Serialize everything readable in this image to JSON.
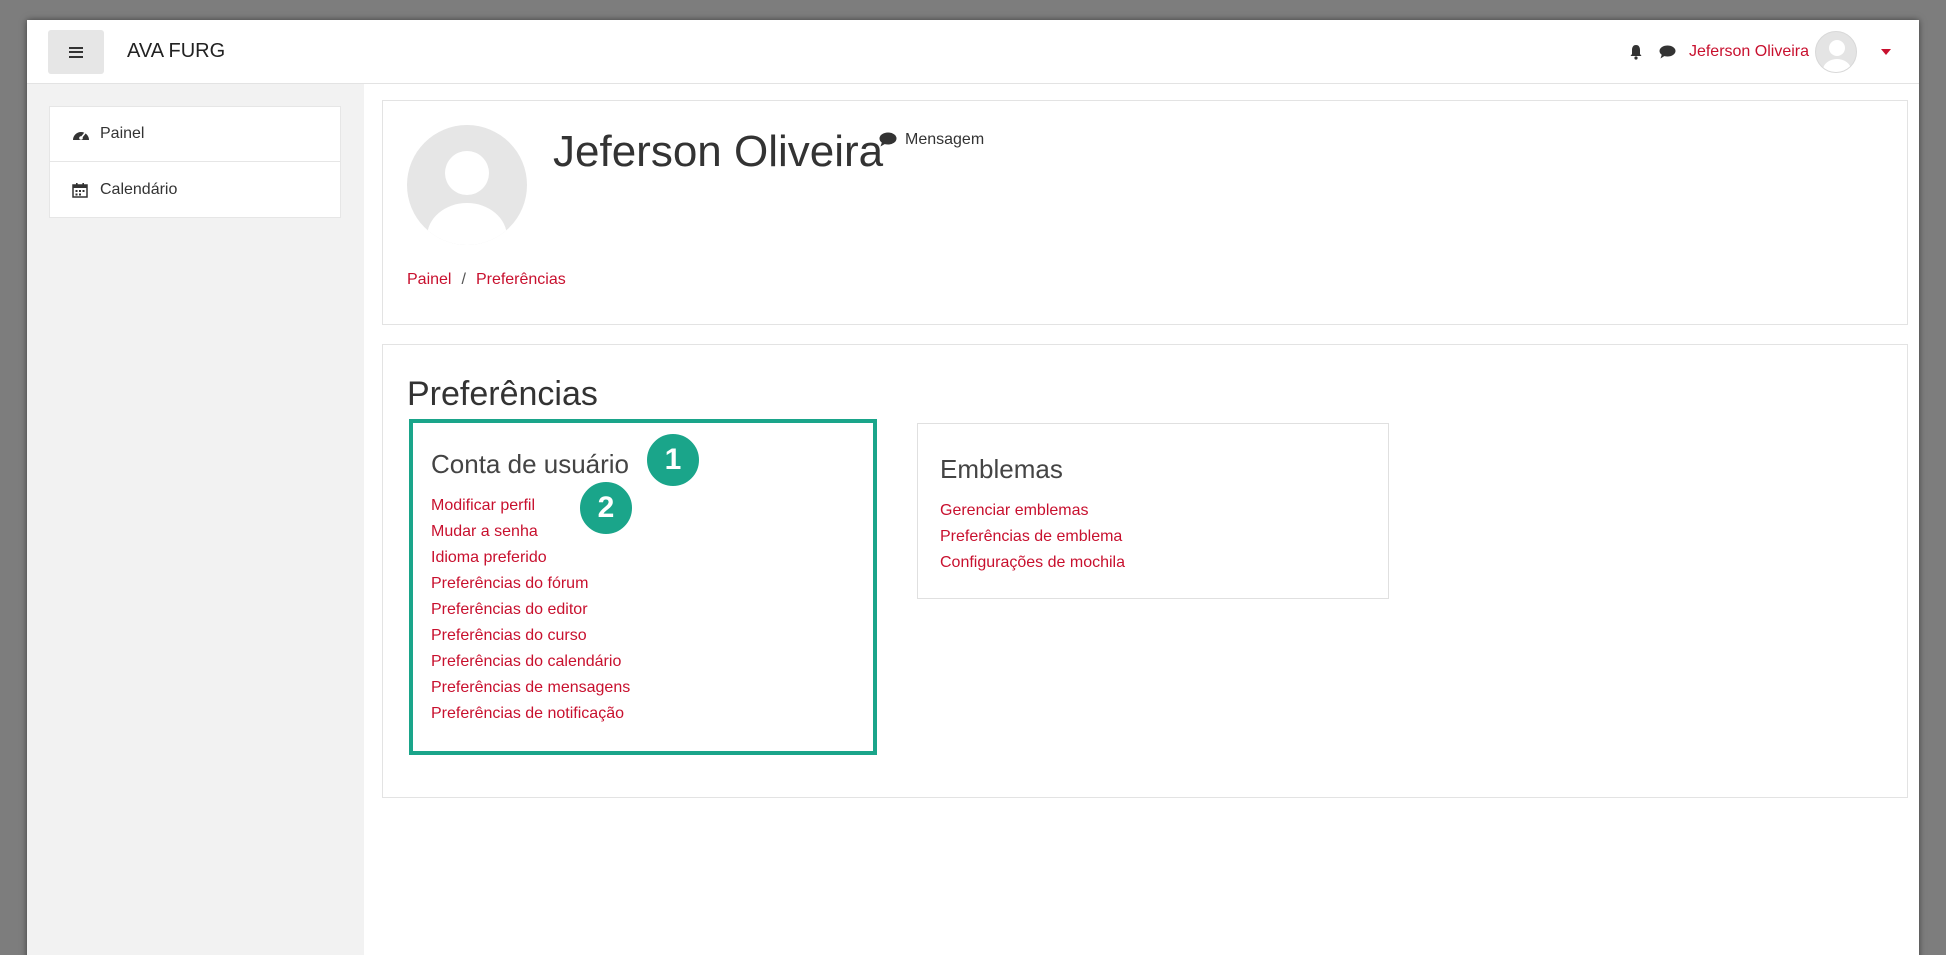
{
  "navbar": {
    "brand": "AVA FURG",
    "user_name": "Jeferson Oliveira",
    "icons": [
      "bell-icon",
      "comment-icon"
    ]
  },
  "sidebar": {
    "items": [
      {
        "label": "Painel",
        "icon": "dashboard-icon"
      },
      {
        "label": "Calendário",
        "icon": "calendar-icon"
      }
    ]
  },
  "profile": {
    "name": "Jeferson Oliveira",
    "message_label": "Mensagem"
  },
  "breadcrumb": [
    "Painel",
    "Preferências"
  ],
  "page": {
    "title": "Preferências",
    "sections": [
      {
        "title": "Conta de usuário",
        "links": [
          "Modificar perfil",
          "Mudar a senha",
          "Idioma preferido",
          "Preferências do fórum",
          "Preferências do editor",
          "Preferências do curso",
          "Preferências do calendário",
          "Preferências de mensagens",
          "Preferências de notificação"
        ]
      },
      {
        "title": "Emblemas",
        "links": [
          "Gerenciar emblemas",
          "Preferências de emblema",
          "Configurações de mochila"
        ]
      }
    ]
  },
  "annotations": [
    "1",
    "2"
  ],
  "colors": {
    "link": "#c8102e",
    "highlight": "#1aa58a"
  }
}
